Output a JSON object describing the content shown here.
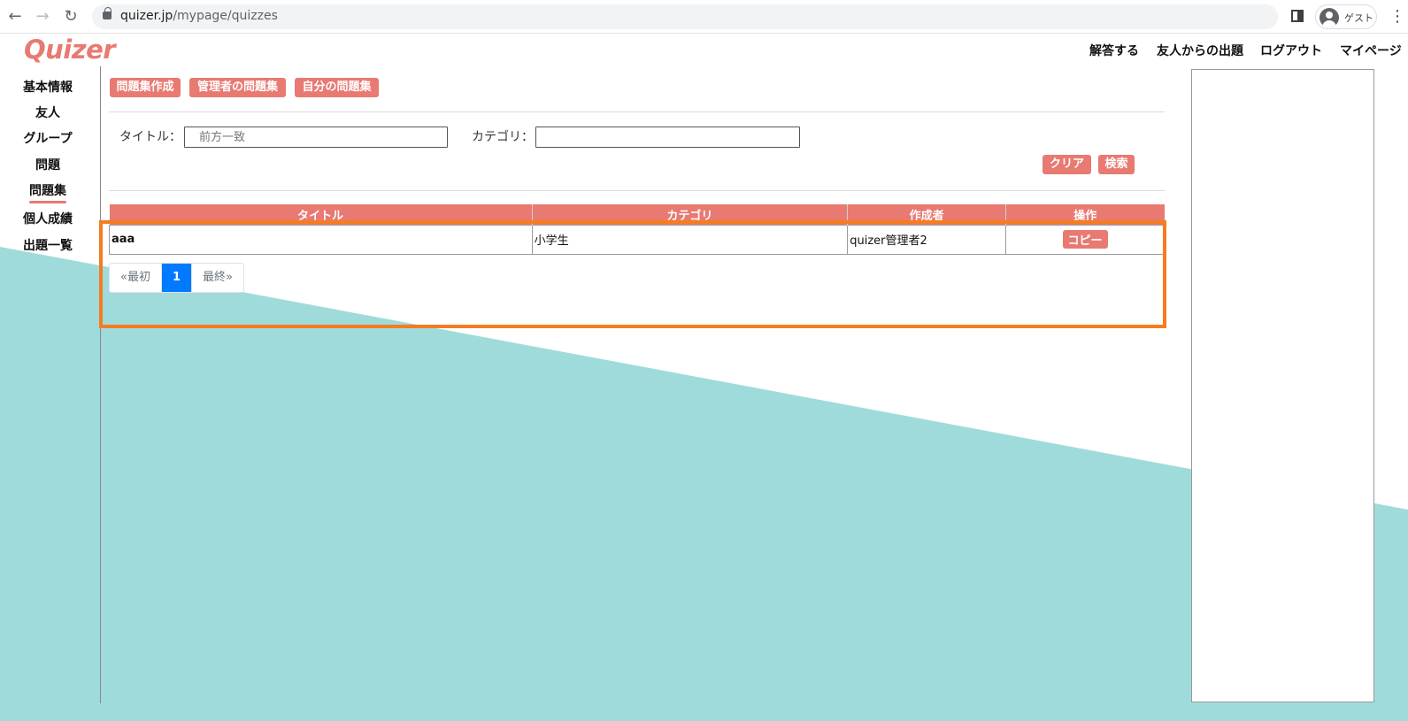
{
  "browser": {
    "url_host": "quizer.jp",
    "url_path": "/mypage/quizzes",
    "profile_label": "ゲスト"
  },
  "site": {
    "logo": "Quizer",
    "topnav": [
      "解答する",
      "友人からの出題",
      "ログアウト",
      "マイページ"
    ]
  },
  "sidebar": {
    "items": [
      "基本情報",
      "友人",
      "グループ",
      "問題",
      "問題集",
      "個人成績",
      "出題一覧"
    ],
    "active": "問題集"
  },
  "actions": [
    "問題集作成",
    "管理者の問題集",
    "自分の問題集"
  ],
  "search": {
    "title_label": "タイトル：",
    "title_placeholder": "前方一致",
    "category_label": "カテゴリ：",
    "category_value": "",
    "clear_label": "クリア",
    "search_label": "検索"
  },
  "table": {
    "headers": [
      "タイトル",
      "カテゴリ",
      "作成者",
      "操作"
    ],
    "rows": [
      {
        "title": "aaa",
        "category": "小学生",
        "author": "quizer管理者2",
        "action": "コピー"
      }
    ]
  },
  "pagination": {
    "first": "«最初",
    "current": "1",
    "last": "最終»"
  },
  "colors": {
    "accent": "#e87a72",
    "teal_bg": "#a0dbdb",
    "highlight": "#f57c20",
    "page_active": "#007bff"
  }
}
